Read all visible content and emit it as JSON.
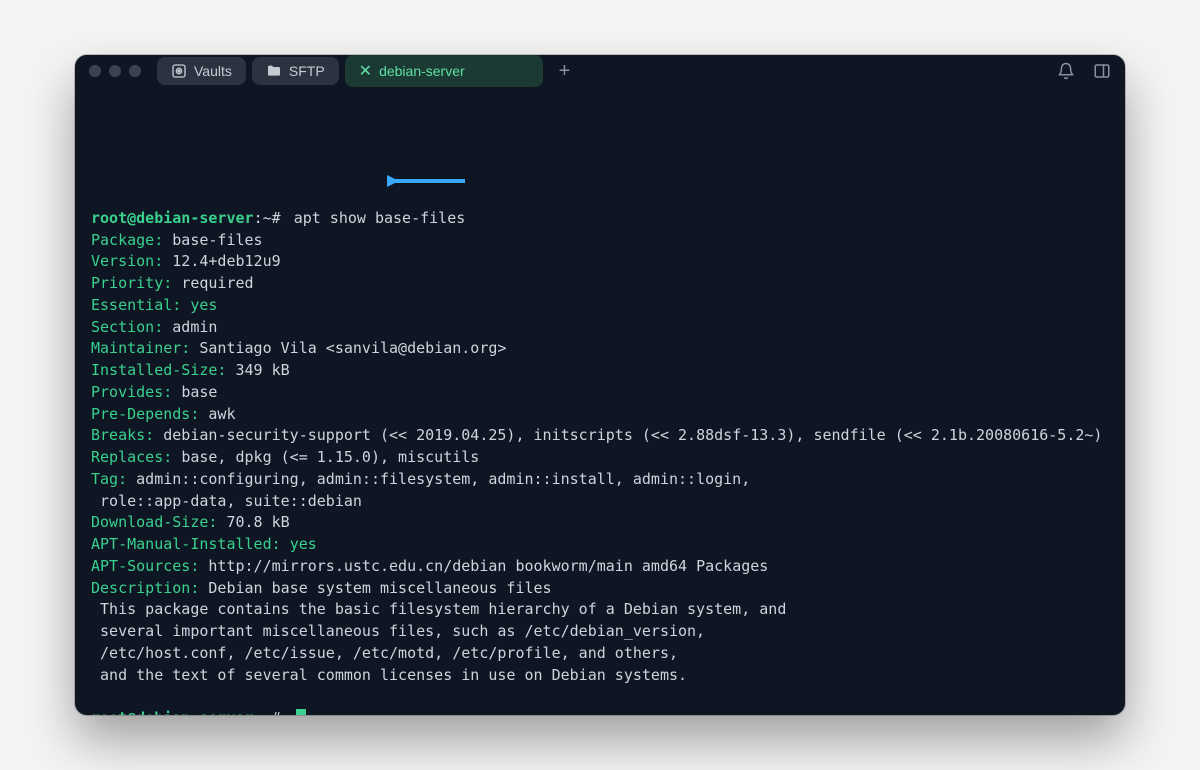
{
  "titlebar": {
    "tabs": [
      {
        "label": "Vaults",
        "kind": "gray",
        "icon": "vault-icon",
        "closable": false
      },
      {
        "label": "SFTP",
        "kind": "gray",
        "icon": "folder-icon",
        "closable": false
      },
      {
        "label": "debian-server",
        "kind": "active",
        "icon": "close-icon",
        "closable": true
      }
    ],
    "add_tab": "+"
  },
  "prompt": {
    "user": "root@debian-server",
    "path": "~",
    "symbol": "#"
  },
  "command": "apt show base-files",
  "fields": [
    {
      "key": "Package",
      "value": "base-files"
    },
    {
      "key": "Version",
      "value": "12.4+deb12u9",
      "annotated": true
    },
    {
      "key": "Priority",
      "value": "required"
    },
    {
      "key": "Essential",
      "value": "yes",
      "value_highlight": true
    },
    {
      "key": "Section",
      "value": "admin"
    },
    {
      "key": "Maintainer",
      "value": "Santiago Vila <sanvila@debian.org>"
    },
    {
      "key": "Installed-Size",
      "value": "349 kB"
    },
    {
      "key": "Provides",
      "value": "base"
    },
    {
      "key": "Pre-Depends",
      "value": "awk"
    },
    {
      "key": "Breaks",
      "value": "debian-security-support (<< 2019.04.25), initscripts (<< 2.88dsf-13.3), sendfile (<< 2.1b.20080616-5.2~)"
    },
    {
      "key": "Replaces",
      "value": "base, dpkg (<= 1.15.0), miscutils"
    },
    {
      "key": "Tag",
      "value": "admin::configuring, admin::filesystem, admin::install, admin::login,\n role::app-data, suite::debian"
    },
    {
      "key": "Download-Size",
      "value": "70.8 kB"
    },
    {
      "key": "APT-Manual-Installed",
      "value": "yes",
      "value_highlight": true
    },
    {
      "key": "APT-Sources",
      "value": "http://mirrors.ustc.edu.cn/debian bookworm/main amd64 Packages"
    },
    {
      "key": "Description",
      "value": "Debian base system miscellaneous files"
    }
  ],
  "description_lines": [
    " This package contains the basic filesystem hierarchy of a Debian system, and",
    " several important miscellaneous files, such as /etc/debian_version,",
    " /etc/host.conf, /etc/issue, /etc/motd, /etc/profile, and others,",
    " and the text of several common licenses in use on Debian systems."
  ],
  "annotation": {
    "color": "#3aa8ff"
  },
  "icons": {
    "bell": "bell-icon",
    "panel": "panel-icon"
  }
}
